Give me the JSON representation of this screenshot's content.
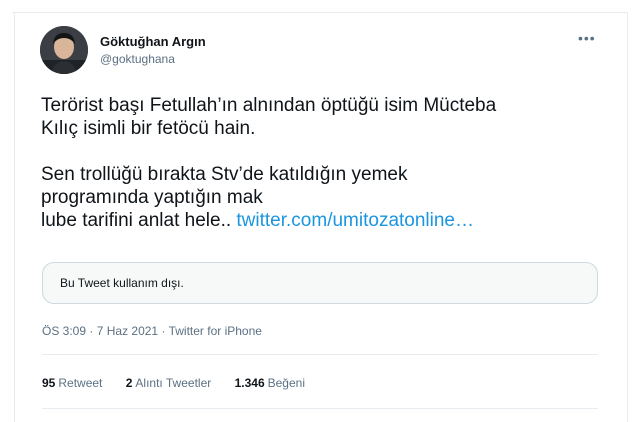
{
  "author": {
    "name": "Göktuğhan Argın",
    "handle": "@goktughana"
  },
  "menu_icon": "more-horizontal-icon",
  "tweet": {
    "lines_paragraph1": [
      "Terörist başı Fetullah’ın alnından öptüğü isim Mücteba",
      "Kılıç isimli bir fetöcü hain."
    ],
    "lines_paragraph2": [
      "Sen trollüğü bırakta Stv’de katıldığın yemek",
      "programında yaptığın mak",
      "lube tarifini anlat hele.."
    ],
    "link": "twitter.com/umitozatonline…"
  },
  "quoted": {
    "text": "Bu Tweet kullanım dışı."
  },
  "meta": {
    "time": "ÖS 3:09",
    "date": "7 Haz 2021",
    "source": "Twitter for iPhone"
  },
  "stats": {
    "retweets_count": "95",
    "retweets_label": "Retweet",
    "quotes_count": "2",
    "quotes_label": "Alıntı Tweetler",
    "likes_count": "1.346",
    "likes_label": "Beğeni"
  },
  "colors": {
    "link": "#1b95e0",
    "secondary_text": "#5b7083",
    "primary_text": "#0f1419",
    "border": "#e6ecf0"
  }
}
